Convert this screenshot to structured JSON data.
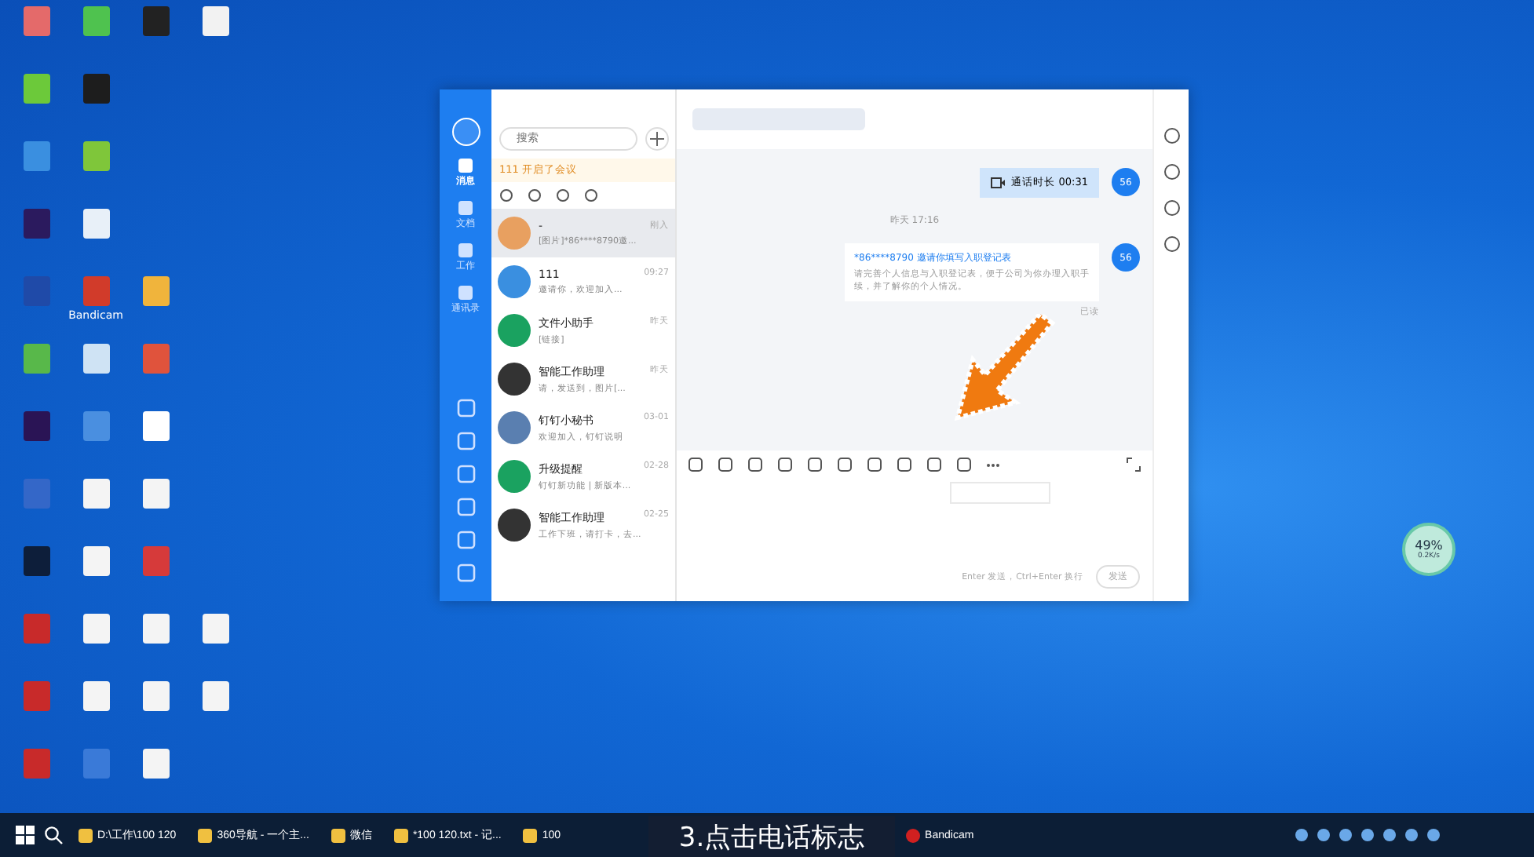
{
  "desktop_icons": [
    [
      {
        "color": "#e46a6a"
      },
      {
        "color": "#4fc24f"
      },
      {
        "color": "#222222"
      },
      {
        "color": "#f2f2f2"
      }
    ],
    [
      {
        "color": "#6cc93a"
      },
      {
        "color": "#1d1d1d"
      }
    ],
    [
      {
        "color": "#3a8fe0"
      },
      {
        "color": "#7fc63a"
      }
    ],
    [
      {
        "color": "#2b1a5e"
      },
      {
        "color": "#e8f0f8"
      }
    ],
    [
      {
        "color": "#1f4aa8"
      },
      {
        "color": "#d13b2a",
        "label": "Bandicam"
      },
      {
        "color": "#f0b43c"
      }
    ],
    [
      {
        "color": "#58b84a"
      },
      {
        "color": "#cfe3f4"
      },
      {
        "color": "#e0533c"
      }
    ],
    [
      {
        "color": "#2a1455"
      },
      {
        "color": "#4a8fe0"
      },
      {
        "color": "#ffffff"
      }
    ],
    [
      {
        "color": "#3467c8"
      },
      {
        "color": "#f4f4f4"
      },
      {
        "color": "#f4f4f4"
      }
    ],
    [
      {
        "color": "#0d1e3a"
      },
      {
        "color": "#f4f4f4"
      },
      {
        "color": "#d63a3a"
      }
    ],
    [
      {
        "color": "#c82a2a"
      },
      {
        "color": "#f4f4f4"
      },
      {
        "color": "#f4f4f4"
      },
      {
        "color": "#f4f4f4"
      }
    ],
    [
      {
        "color": "#c82a2a"
      },
      {
        "color": "#f4f4f4"
      },
      {
        "color": "#f4f4f4"
      },
      {
        "color": "#f4f4f4"
      }
    ],
    [
      {
        "color": "#c82a2a"
      },
      {
        "color": "#3a7ad8"
      },
      {
        "color": "#f4f4f4"
      }
    ]
  ],
  "app": {
    "nav": [
      {
        "label": "消息",
        "selected": true
      },
      {
        "label": "文档",
        "selected": false
      },
      {
        "label": "工作",
        "selected": false
      },
      {
        "label": "通讯录",
        "selected": false
      }
    ],
    "search": {
      "placeholder": "搜索"
    },
    "banner": "111 开启了会议",
    "chats": [
      {
        "name": "-",
        "time": "刚入",
        "preview": "[图片]*86****8790邀...",
        "color": "#e8a060",
        "selected": true
      },
      {
        "name": "111",
        "time": "09:27",
        "preview": "邀请你，欢迎加入...",
        "color": "#3a8fe0",
        "selected": false
      },
      {
        "name": "文件小助手",
        "time": "昨天",
        "preview": "[链接]",
        "color": "#1aa260",
        "selected": false
      },
      {
        "name": "智能工作助理",
        "time": "昨天",
        "preview": "请，发送到，图片[...",
        "color": "#333333",
        "selected": false
      },
      {
        "name": "钉钉小秘书",
        "time": "03-01",
        "preview": "欢迎加入，钉钉说明",
        "color": "#5a7fb0",
        "selected": false
      },
      {
        "name": "升级提醒",
        "time": "02-28",
        "preview": "钉钉新功能 | 新版本...",
        "color": "#1aa260",
        "selected": false
      },
      {
        "name": "智能工作助理",
        "time": "02-25",
        "preview": "工作下班，请打卡，去...",
        "color": "#333333",
        "selected": false
      }
    ],
    "call": {
      "text": "通话时长 00:31",
      "avatar": "56"
    },
    "divider": "昨天 17:16",
    "card": {
      "title": "*86****8790 邀请你填写入职登记表",
      "body": "请完善个人信息与入职登记表，便于公司为你办理入职手续，并了解你的个人情况。",
      "avatar": "56",
      "status": "已读"
    },
    "send_hint": "Enter 发送，Ctrl+Enter 换行",
    "send_button": "发送"
  },
  "widget": {
    "percent": "49%",
    "speed": "0.2K/s"
  },
  "caption": "3.点击电话标志",
  "taskbar": [
    "D:\\工作\\100 120",
    "360导航 - 一个主...",
    "微信",
    "*100 120.txt - 记...",
    "100"
  ],
  "taskbar_right": "Bandicam"
}
